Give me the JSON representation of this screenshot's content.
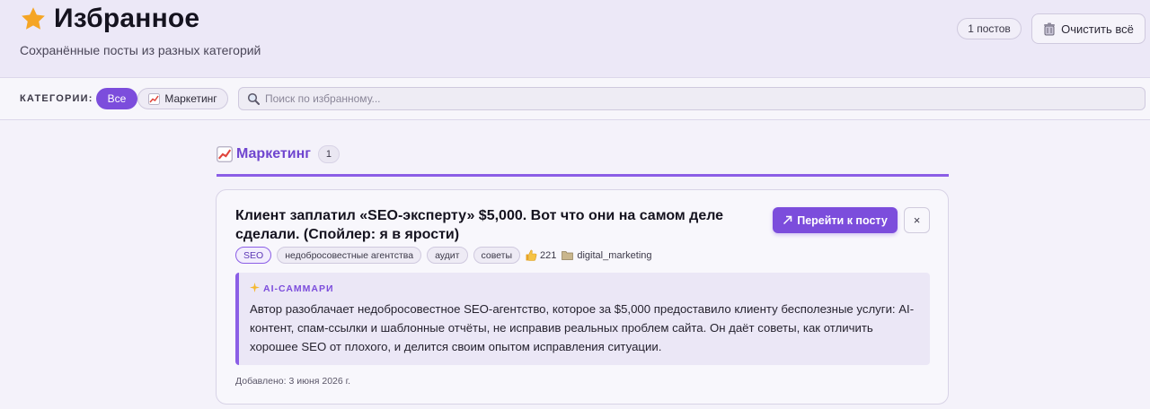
{
  "header": {
    "title": "Избранное",
    "subtitle": "Сохранённые посты из разных категорий",
    "count_badge": "1 постов",
    "clear_button": "Очистить всё"
  },
  "filters": {
    "label": "КАТЕГОРИИ:",
    "all": "Все",
    "marketing": "Маркетинг",
    "search_placeholder": "Поиск по избранному..."
  },
  "section": {
    "title": "Маркетинг",
    "count": "1"
  },
  "post": {
    "title": "Клиент заплатил «SEO-эксперту» $5,000. Вот что они на самом деле сделали. (Спойлер: я в ярости)",
    "go_button": "Перейти к посту",
    "remove_button": "×",
    "tags": [
      "SEO",
      "недобросовестные агентства",
      "аудит",
      "советы"
    ],
    "likes": "221",
    "source": "digital_marketing",
    "summary_label": "AI-САММАРИ",
    "summary": "Автор разоблачает недобросовестное SEO-агентство, которое за $5,000 предоставило клиенту бесполезные услуги: AI-контент, спам-ссылки и шаблонные отчёты, не исправив реальных проблем сайта. Он даёт советы, как отличить хорошее SEO от плохого, и делится своим опытом исправления ситуации.",
    "added": "Добавлено: 3 июня 2026 г."
  },
  "colors": {
    "accent": "#7c4ddc",
    "star": "#f5a524"
  },
  "icons": [
    "star-icon",
    "trash-icon",
    "chart-icon",
    "search-icon",
    "arrow-icon",
    "thumbs-up-icon",
    "folder-icon",
    "sparkle-icon"
  ]
}
